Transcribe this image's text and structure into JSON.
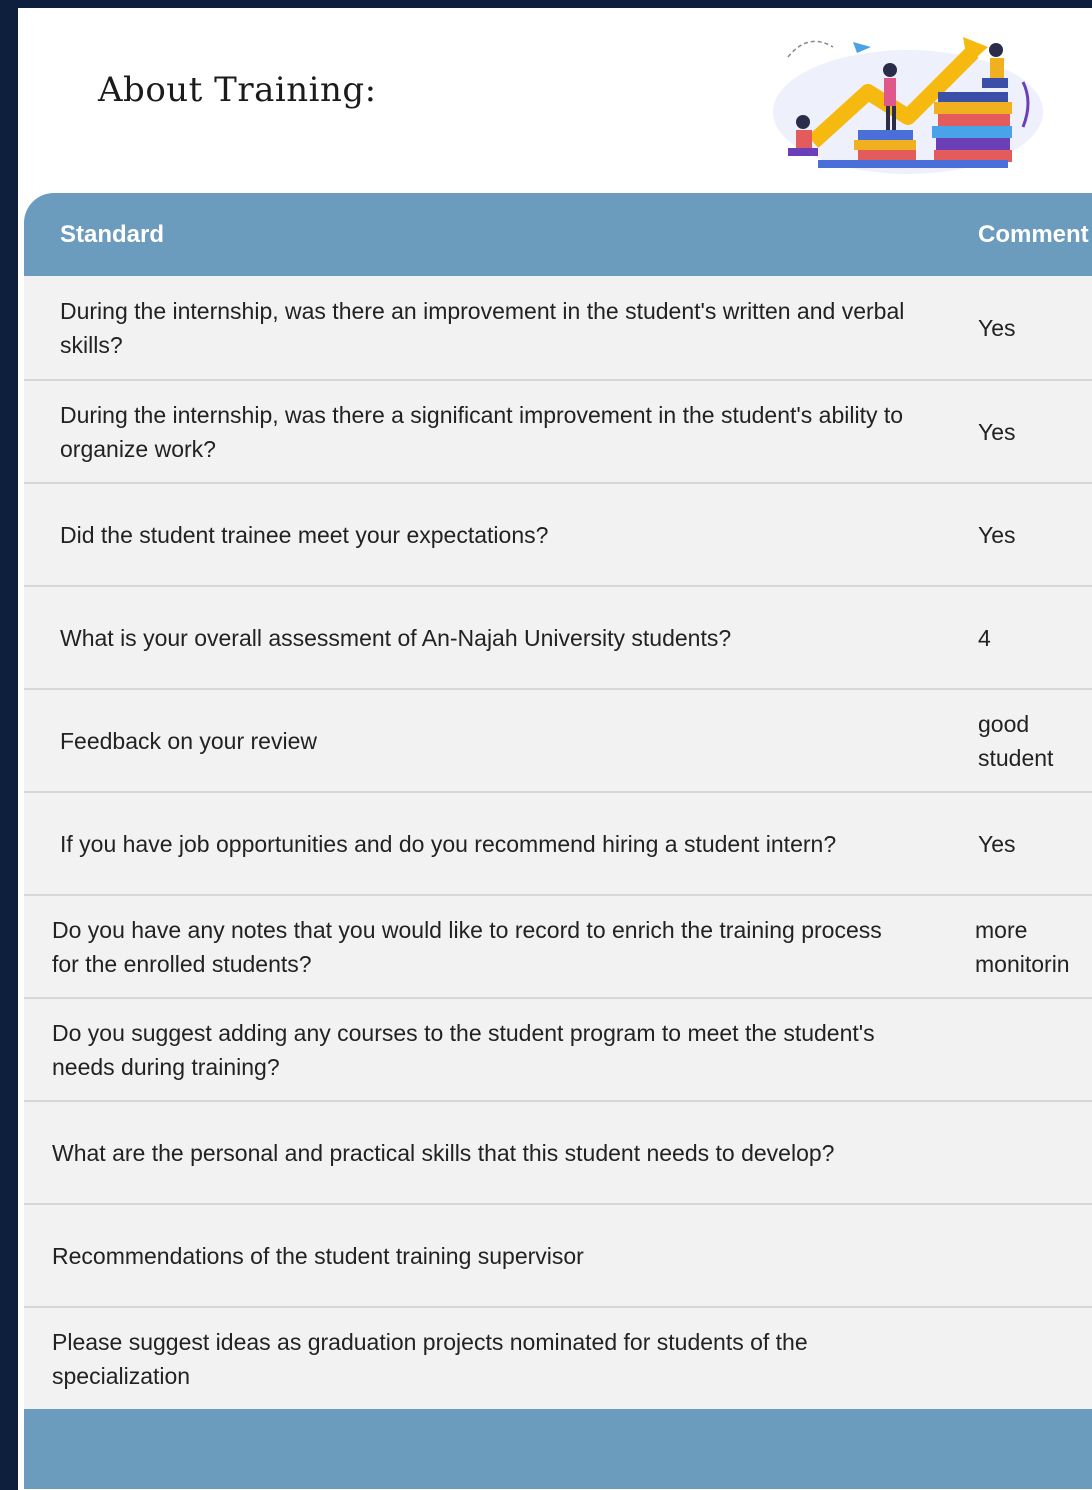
{
  "page": {
    "heading": "About Training:",
    "accent_color": "#6b9bbd",
    "background_color": "#0d1f3c"
  },
  "illustration": {
    "icon": "growth-chart-illustration-icon"
  },
  "table": {
    "headers": {
      "standard": "Standard",
      "comment": "Comment"
    },
    "rows": [
      {
        "question": "During the internship, was there an improvement in the student's written and verbal skills?",
        "comment": "Yes"
      },
      {
        "question": "During the internship, was there a significant improvement in the student's ability to organize work?",
        "comment": "Yes"
      },
      {
        "question": "Did the student trainee meet your expectations?",
        "comment": "Yes"
      },
      {
        "question": "What is your overall assessment of An-Najah University students?",
        "comment": "4"
      },
      {
        "question": "Feedback on your review",
        "comment": "good student"
      },
      {
        "question": "If you have job opportunities and do you recommend hiring a student intern?",
        "comment": "Yes"
      },
      {
        "question": "Do you have any notes that you would like to record to enrich the training process for the enrolled students?",
        "comment": "more monitorin"
      },
      {
        "question": "Do you suggest adding any courses to the student program to meet the student's needs during training?",
        "comment": ""
      },
      {
        "question": "What are the personal and practical skills that this student needs to develop?",
        "comment": ""
      },
      {
        "question": "Recommendations of the student training supervisor",
        "comment": ""
      },
      {
        "question": "Please suggest ideas as graduation projects nominated for students of the specialization",
        "comment": ""
      }
    ]
  }
}
